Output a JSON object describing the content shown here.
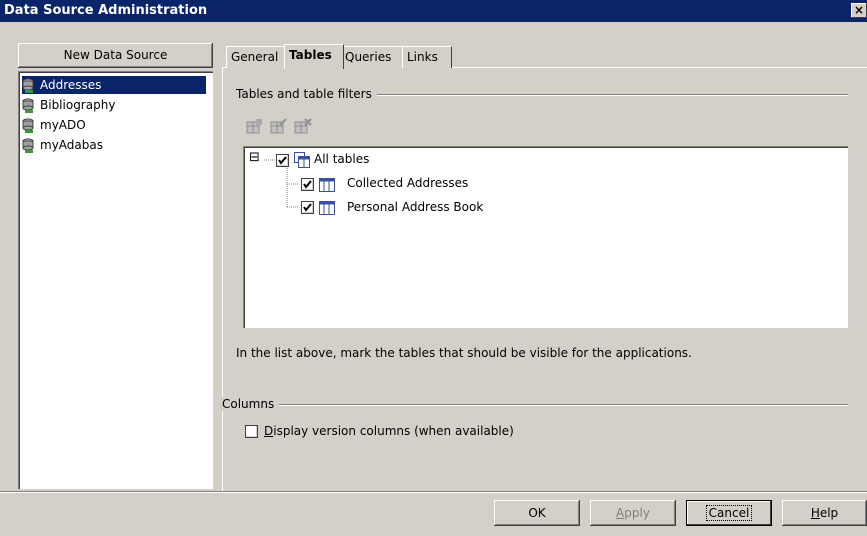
{
  "window": {
    "title": "Data Source Administration",
    "close_label": "×"
  },
  "new_data_source_label": "New Data Source",
  "data_sources": [
    {
      "label": "Addresses",
      "selected": true
    },
    {
      "label": "Bibliography",
      "selected": false
    },
    {
      "label": "myADO",
      "selected": false
    },
    {
      "label": "myAdabas",
      "selected": false
    }
  ],
  "tabs": [
    {
      "label": "General",
      "active": false
    },
    {
      "label": "Tables",
      "active": true
    },
    {
      "label": "Queries",
      "active": false
    },
    {
      "label": "Links",
      "active": false
    }
  ],
  "tables_section": {
    "group_label": "Tables and table filters",
    "toolbar_icons": [
      "new-filter-icon",
      "edit-filter-icon",
      "delete-filter-icon"
    ],
    "tree": {
      "expander": "⊟",
      "root": {
        "label": "All tables",
        "checked": true
      },
      "children": [
        {
          "label": "Collected Addresses",
          "checked": true
        },
        {
          "label": "Personal Address Book",
          "checked": true
        }
      ]
    },
    "hint": "In the list above, mark the tables that should be visible for the applications."
  },
  "columns_section": {
    "group_label": "Columns",
    "checkbox_prefix": "D",
    "checkbox_label": "isplay version columns (when available)",
    "checked": false
  },
  "footer": {
    "ok_label": "OK",
    "apply_prefix": "A",
    "apply_label": "pply",
    "cancel_label": "Cancel",
    "help_prefix": "H",
    "help_label": "elp"
  },
  "colors": {
    "title_bar": "#0a246a",
    "selection": "#0a246a",
    "face": "#d4d0c8",
    "disabled_text": "#808080"
  }
}
